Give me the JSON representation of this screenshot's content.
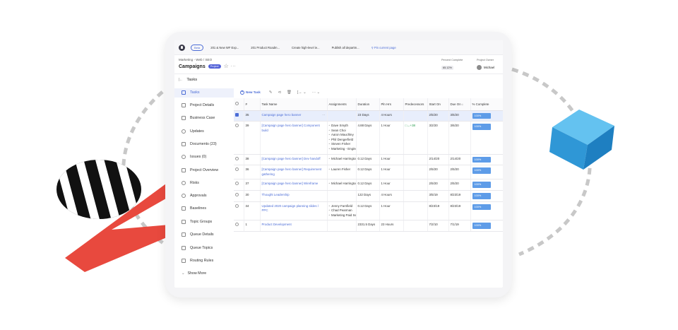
{
  "topbar": {
    "beta": "Beta",
    "tabs": [
      "201 & New WF Exp...",
      "201 Product Roadm...",
      "Create high-level ie...",
      "Publish all departm..."
    ],
    "pin": "Pin current page"
  },
  "header": {
    "breadcrumb": "Marketing - Web / SEO",
    "title": "Campaigns",
    "badge": "Project",
    "percent_label": "Percent Complete",
    "percent_value": "65.12%",
    "owner_label": "Project Owner",
    "owner_name": "Michael"
  },
  "section_title": "Tasks",
  "sidebar": {
    "items": [
      {
        "label": "Tasks",
        "icon": "tasks-icon"
      },
      {
        "label": "Project Details",
        "icon": "details-icon"
      },
      {
        "label": "Business Case",
        "icon": "briefcase-icon"
      },
      {
        "label": "Updates",
        "icon": "chat-icon"
      },
      {
        "label": "Documents (23)",
        "icon": "document-icon"
      },
      {
        "label": "Issues (0)",
        "icon": "issues-icon"
      },
      {
        "label": "Project Overview",
        "icon": "overview-icon"
      },
      {
        "label": "Risks",
        "icon": "risk-icon"
      },
      {
        "label": "Approvals",
        "icon": "approval-icon"
      },
      {
        "label": "Baselines",
        "icon": "baseline-icon"
      },
      {
        "label": "Topic Groups",
        "icon": "topic-icon"
      },
      {
        "label": "Queue Details",
        "icon": "queue-icon"
      },
      {
        "label": "Queue Topics",
        "icon": "queue-topics-icon"
      },
      {
        "label": "Routing Rules",
        "icon": "routing-icon"
      },
      {
        "label": "Show More",
        "icon": "chevron-down-icon"
      }
    ]
  },
  "toolbar": {
    "new_task": "New Task"
  },
  "table": {
    "headers": [
      "",
      "#",
      "Task Name",
      "Assignments",
      "Duration",
      "Pln Hrs",
      "Predecessors",
      "Start On",
      "Due On",
      "% Complete"
    ],
    "rows": [
      {
        "num": "35",
        "name": "Campaign page hero banner",
        "assignments": [],
        "duration": "23 Days",
        "hours": "4 Hours",
        "pred": "",
        "start": "2/5/20",
        "due": "3/6/20",
        "pct": "100%",
        "selected": true
      },
      {
        "num": "39",
        "name": "[Campaign page hero banner] Component build",
        "assignments": [
          "Dave Smyth",
          "Sean Choi",
          "Aaron Mauchley",
          "Phil Dengerfield",
          "Steven Fisher",
          "Marketing - Engineering"
        ],
        "duration": "4.88 Days",
        "hours": "1 Hour",
        "pred": "+38",
        "start": "3/2/20",
        "due": "3/6/20",
        "pct": "100%",
        "selected": false
      },
      {
        "num": "38",
        "name": "[Campaign page hero banner] Dev handoff",
        "assignments": [
          "Michael Harrington"
        ],
        "duration": "0.12 Days",
        "hours": "1 Hour",
        "pred": "",
        "start": "2/14/20",
        "due": "2/14/20",
        "pct": "100%",
        "selected": false
      },
      {
        "num": "36",
        "name": "[Campaign page hero banner] Requirement gathering",
        "assignments": [
          "Lauren Fisher"
        ],
        "duration": "0.12 Days",
        "hours": "1 Hour",
        "pred": "",
        "start": "2/5/20",
        "due": "2/5/20",
        "pct": "100%",
        "selected": false
      },
      {
        "num": "37",
        "name": "[Campaign page hero banner] Wireframe",
        "assignments": [
          "Michael Harrington"
        ],
        "duration": "0.12 Days",
        "hours": "1 Hour",
        "pred": "",
        "start": "2/5/20",
        "due": "2/5/20",
        "pct": "100%",
        "selected": false
      },
      {
        "num": "30",
        "name": "Thought Leadership",
        "assignments": [],
        "duration": "122 Days",
        "hours": "4 Hours",
        "pred": "",
        "start": "3/5/19",
        "due": "8/23/19",
        "pct": "100%",
        "selected": false
      },
      {
        "num": "34",
        "name": "Updated 2020 campaign planning slides / PPC",
        "assignments": [
          "Jenny Farnfield",
          "Chad Pearman",
          "Marketing Paid Search"
        ],
        "duration": "0.12 Days",
        "hours": "1 Hour",
        "pred": "",
        "start": "8/23/19",
        "due": "8/23/19",
        "pct": "100%",
        "selected": false
      },
      {
        "num": "1",
        "name": "Product Development",
        "assignments": [],
        "duration": "2331.5 Days",
        "hours": "23 Hours",
        "pred": "",
        "start": "7/2/10",
        "due": "7/1/19",
        "pct": "100%",
        "selected": false
      }
    ]
  },
  "colors": {
    "accent": "#4b6cd6",
    "progress": "#5e9ce8",
    "deco_red": "#e8493e",
    "deco_cube": "#3aa7e2"
  }
}
